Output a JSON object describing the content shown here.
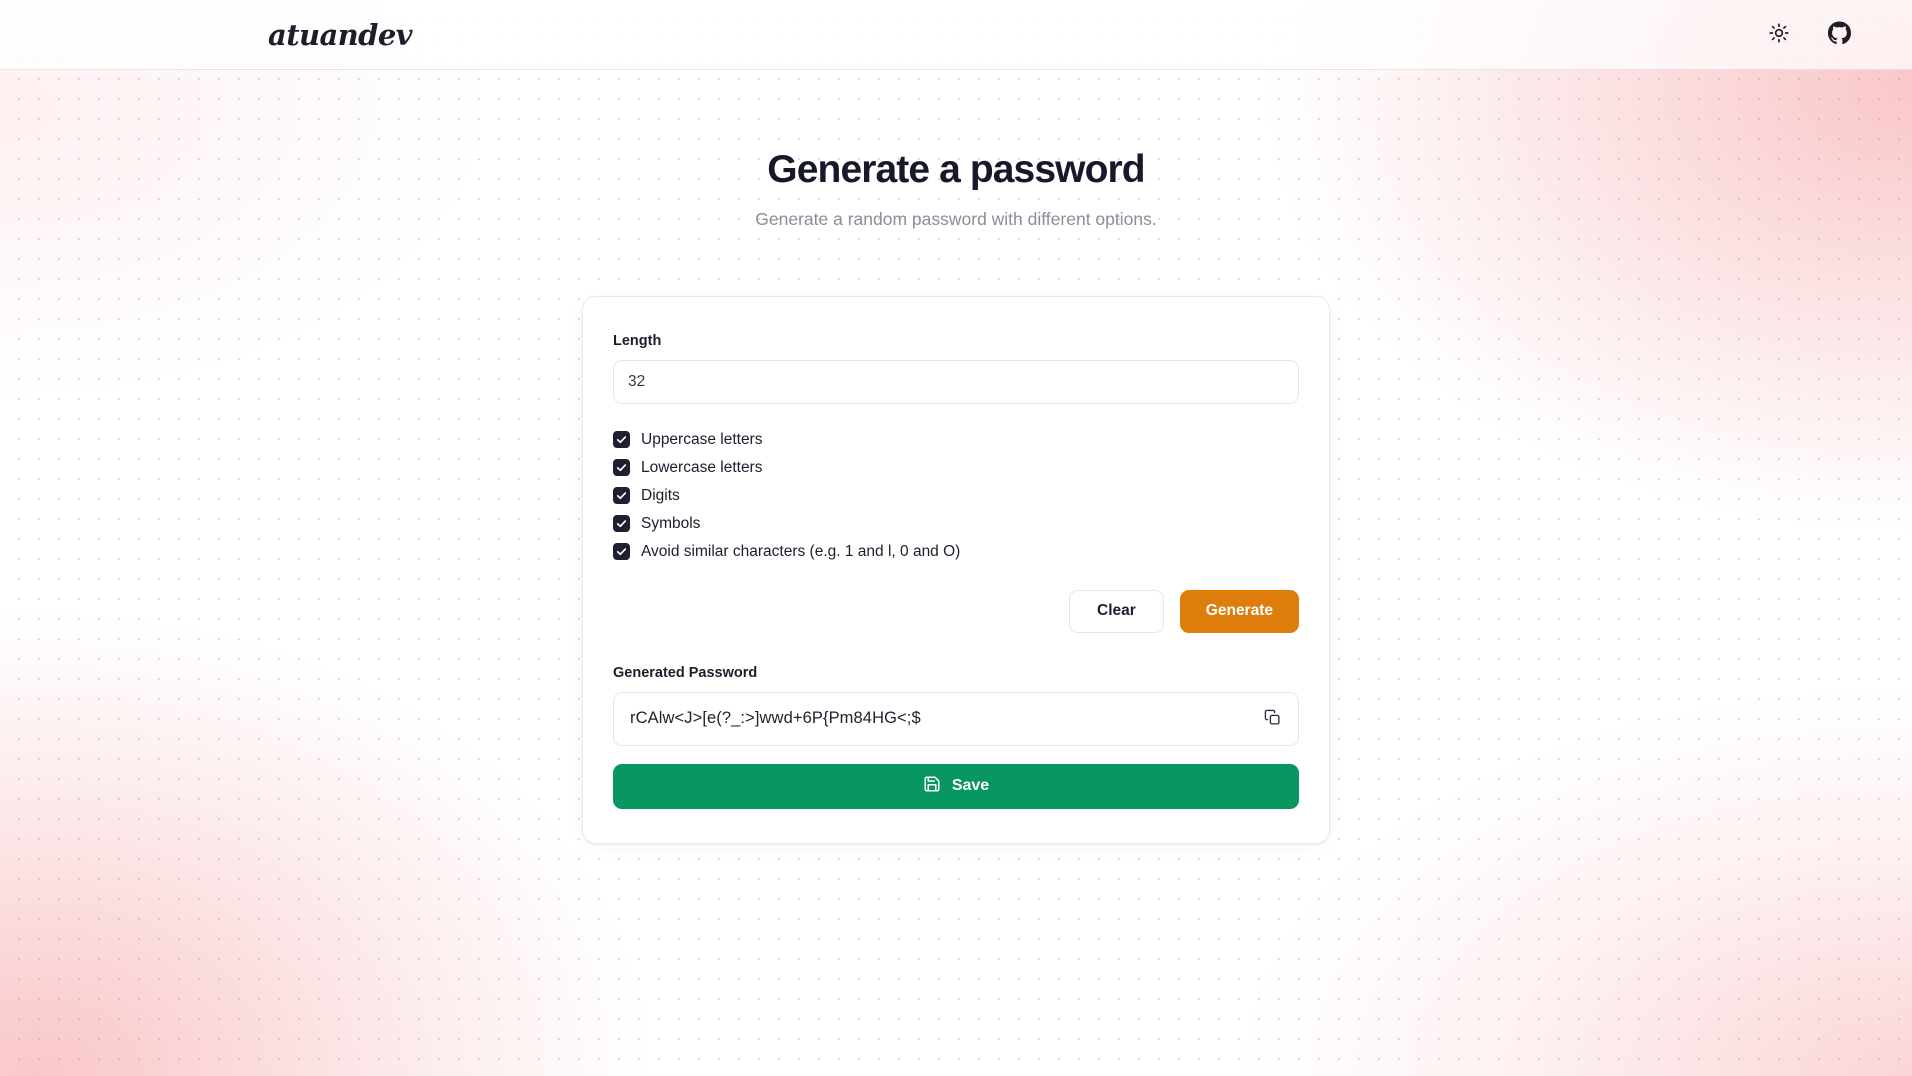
{
  "header": {
    "brand": "atuandev",
    "theme_toggle_icon": "sun-icon",
    "github_icon": "github-icon"
  },
  "hero": {
    "title": "Generate a password",
    "subtitle": "Generate a random password with different options."
  },
  "form": {
    "length": {
      "label": "Length",
      "value": "32",
      "placeholder": "32"
    },
    "options": [
      {
        "label": "Uppercase letters",
        "checked": true
      },
      {
        "label": "Lowercase letters",
        "checked": true
      },
      {
        "label": "Digits",
        "checked": true
      },
      {
        "label": "Symbols",
        "checked": true
      },
      {
        "label": "Avoid similar characters (e.g. 1 and l, 0 and O)",
        "checked": true
      }
    ],
    "clear_label": "Clear",
    "generate_label": "Generate"
  },
  "result": {
    "label": "Generated Password",
    "password": "rCAlw<J>[e(?_:>]wwd+6P{Pm84HG<;$",
    "copy_icon": "copy-icon",
    "save_label": "Save",
    "save_icon": "save-floppy-icon"
  },
  "colors": {
    "accent_orange": "#df7d0c",
    "accent_green": "#089761",
    "checkbox_dark": "#1c2030",
    "text_dark": "#1c1f2b",
    "text_muted": "#8b8d98",
    "background_pink": "#f9c4c6"
  }
}
